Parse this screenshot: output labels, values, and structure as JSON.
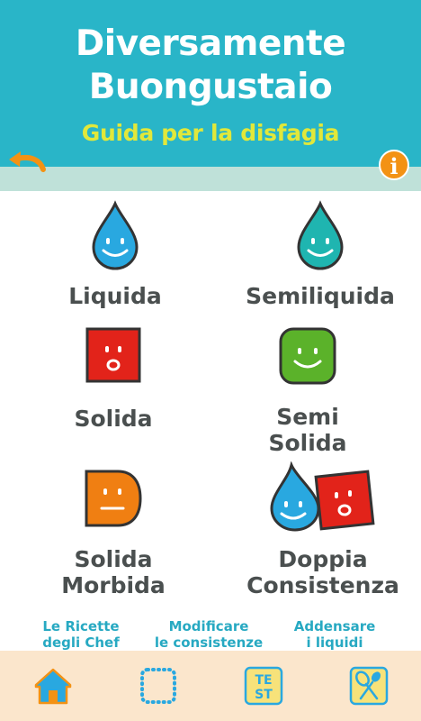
{
  "header": {
    "title_line1": "Diversamente",
    "title_line2": "Buongustaio",
    "subtitle": "Guida per la disfagia",
    "info_label": "i"
  },
  "categories": [
    {
      "label": "Liquida",
      "icon": "blue-drop-smile-icon",
      "color": "#29a8e0"
    },
    {
      "label": "Semiliquida",
      "icon": "teal-drop-smile-icon",
      "color": "#1fb5b0"
    },
    {
      "label": "Solida",
      "icon": "red-square-surprised-icon",
      "color": "#e2231a"
    },
    {
      "label": "Semi\nSolida",
      "icon": "green-square-smile-icon",
      "color": "#5bb22a"
    },
    {
      "label": "Solida\nMorbida",
      "icon": "orange-d-neutral-icon",
      "color": "#f07f12"
    },
    {
      "label": "Doppia\nConsistenza",
      "icon": "drop-and-square-icon",
      "color": "#29a8e0"
    }
  ],
  "links": [
    {
      "label": "Le Ricette\ndegli Chef"
    },
    {
      "label": "Modificare\nle consistenze"
    },
    {
      "label": "Addensare\ni liquidi"
    }
  ],
  "tabbar": {
    "items": [
      "home-icon",
      "dotted-square-icon",
      "test-icon",
      "whisk-spoon-icon"
    ],
    "test_label": "TEST"
  },
  "colors": {
    "header_bg": "#29b5c8",
    "subtitle": "#e1e83a",
    "accent_orange": "#f39214",
    "link": "#27a9c2",
    "tabbar_bg": "#fbe6cc"
  }
}
